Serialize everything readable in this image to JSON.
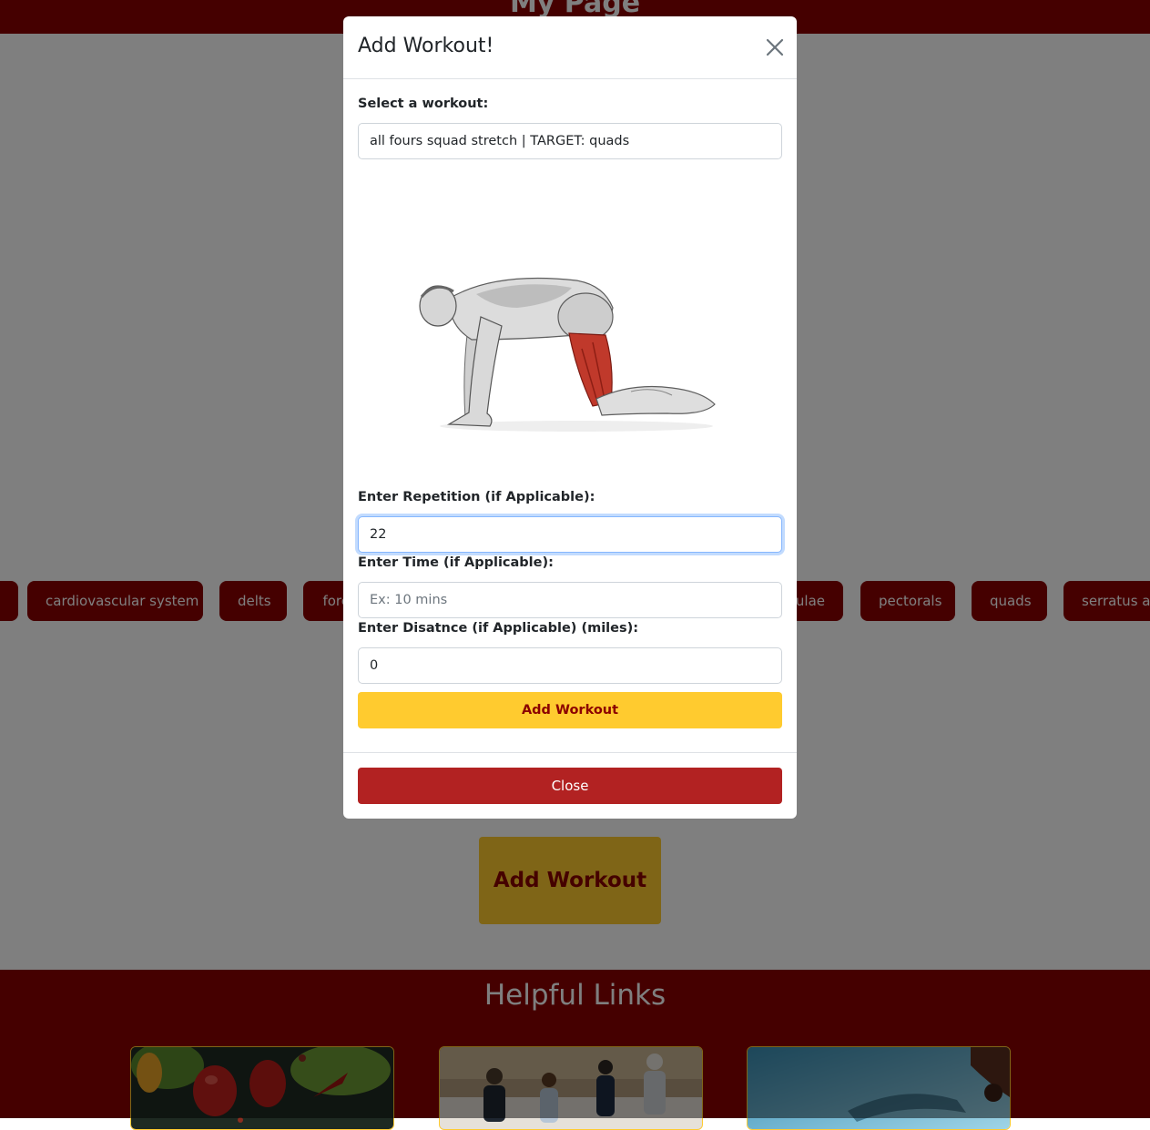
{
  "page": {
    "title": "My Page",
    "muscle_pills": [
      "",
      "cardiovascular system",
      "delts",
      "forearms",
      "",
      "",
      "",
      "scapulae",
      "pectorals",
      "quads",
      "serratus anterior"
    ],
    "add_workout_button": "Add Workout",
    "footer_title": "Helpful Links",
    "link_cards": [
      "vegetables",
      "runners",
      "swimmer"
    ]
  },
  "modal": {
    "title": "Add Workout!",
    "select_label": "Select a workout:",
    "select_value": "all fours squad stretch | TARGET: quads",
    "repetition_label": "Enter Repetition (if Applicable):",
    "repetition_value": "22",
    "time_label": "Enter Time (if Applicable):",
    "time_placeholder": "Ex: 10 mins",
    "distance_label": "Enter Disatnce (if Applicable) (miles):",
    "distance_value": "0",
    "add_button": "Add Workout",
    "close_button": "Close"
  },
  "colors": {
    "brand_red": "#8b0000",
    "accent_yellow": "#ffcb2f",
    "close_red": "#b22222",
    "target_muscle": "#c0392b"
  },
  "icons": [
    "close-icon"
  ]
}
